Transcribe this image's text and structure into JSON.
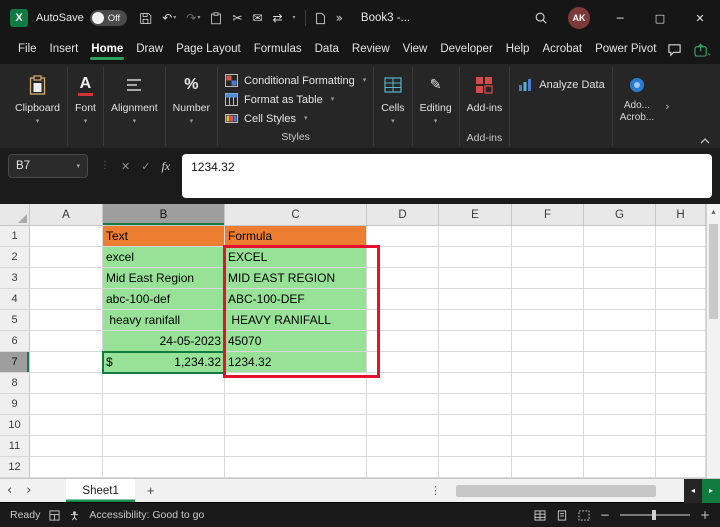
{
  "colors": {
    "accent_green": "#107C41",
    "tab_underline_green": "#2E9E5B",
    "header_orange": "#ED7D31",
    "cell_green": "#97E297",
    "annotation_red": "#E8112D"
  },
  "titlebar": {
    "autosave_label": "AutoSave",
    "autosave_state": "Off",
    "title": "Book3 -...",
    "avatar_initials": "AK",
    "minimize_glyph": "─",
    "maximize_glyph": "□",
    "close_glyph": "✕"
  },
  "menu": {
    "tabs": [
      "File",
      "Insert",
      "Home",
      "Draw",
      "Page Layout",
      "Formulas",
      "Data",
      "Review",
      "View",
      "Developer",
      "Help",
      "Acrobat",
      "Power Pivot"
    ],
    "active_tab": "Home"
  },
  "ribbon": {
    "clipboard_label": "Clipboard",
    "font_label": "Font",
    "alignment_label": "Alignment",
    "number_label": "Number",
    "styles": {
      "conditional_formatting": "Conditional Formatting",
      "format_as_table": "Format as Table",
      "cell_styles": "Cell Styles",
      "group_label": "Styles"
    },
    "cells_label": "Cells",
    "editing_label": "Editing",
    "addins_button_label": "Add-ins",
    "addins_group_label": "Add-ins",
    "analyze_data_label": "Analyze Data",
    "adobe_label_line1": "Ado...",
    "adobe_label_line2": "Acrob..."
  },
  "formula_bar": {
    "name_box_value": "B7",
    "cancel_glyph": "✕",
    "enter_glyph": "✓",
    "fx_label": "fx",
    "content": "1234.32"
  },
  "grid": {
    "col_headers": [
      "A",
      "B",
      "C",
      "D",
      "E",
      "F",
      "G",
      "H"
    ],
    "row_count": 12,
    "selected_cell": "B7",
    "selected_col": "B",
    "selected_row": 7,
    "cells": {
      "B1": {
        "text": "Text",
        "style": "orange"
      },
      "C1": {
        "text": "Formula",
        "style": "orange"
      },
      "B2": {
        "text": "excel",
        "style": "green"
      },
      "C2": {
        "text": "EXCEL",
        "style": "green"
      },
      "B3": {
        "text": "Mid East Region",
        "style": "green"
      },
      "C3": {
        "text": "MID EAST REGION",
        "style": "green"
      },
      "B4": {
        "text": "abc-100-def",
        "style": "green"
      },
      "C4": {
        "text": "ABC-100-DEF",
        "style": "green"
      },
      "B5": {
        "text": " heavy ranifall",
        "style": "green"
      },
      "C5": {
        "text": " HEAVY RANIFALL",
        "style": "green"
      },
      "B6": {
        "text": "24-05-2023",
        "style": "green",
        "align": "right"
      },
      "C6": {
        "text": "45070",
        "style": "green"
      },
      "B7": {
        "text": "1,234.32",
        "prefix": "$",
        "style": "green",
        "align": "right"
      },
      "C7": {
        "text": "1234.32",
        "style": "green"
      }
    },
    "annotation": {
      "range": "C2:C7",
      "color": "#E8112D"
    }
  },
  "sheet_bar": {
    "tabs": [
      "Sheet1"
    ],
    "active_tab": "Sheet1",
    "add_glyph": "+"
  },
  "status_bar": {
    "mode": "Ready",
    "accessibility": "Accessibility: Good to go"
  }
}
